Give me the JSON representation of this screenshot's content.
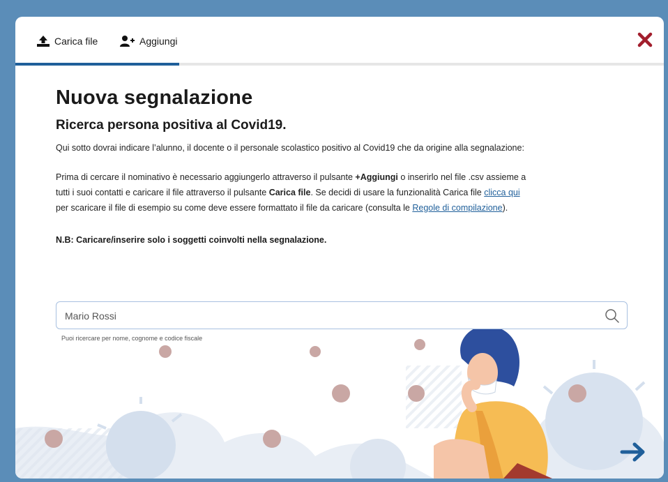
{
  "tabs": {
    "upload_label": "Carica file",
    "add_label": "Aggiungi"
  },
  "header": {
    "title": "Nuova segnalazione",
    "subtitle": "Ricerca persona positiva al Covid19."
  },
  "body": {
    "intro": "Qui sotto dovrai indicare l’alunno, il docente o il personale scolastico positivo al Covid19 che da origine alla segnalazione:",
    "p2_part1": "Prima di cercare il nominativo è necessario aggiungerlo attraverso il pulsante ",
    "p2_bold1": "+Aggiungi",
    "p2_part2": " o inserirlo nel file .csv assieme a tutti i suoi contatti e caricare il file attraverso il pulsante ",
    "p2_bold2": "Carica file",
    "p2_part3": ". Se decidi di usare la funzionalità Carica file ",
    "p2_link1": "clicca qui",
    "p2_part4": " per scaricare il file di esempio su come deve essere formattato il file da caricare (consulta le ",
    "p2_link2": "Regole di compilazione",
    "p2_part5": ").",
    "nb": "N.B: Caricare/inserire solo i soggetti coinvolti nella segnalazione."
  },
  "search": {
    "placeholder": "Mario Rossi",
    "hint": "Puoi ricercare per nome, cognome e codice fiscale"
  },
  "icons": {
    "upload": "upload-icon",
    "add_user": "add-user-icon",
    "close": "close-icon",
    "search": "search-icon",
    "next": "arrow-right-icon"
  },
  "colors": {
    "accent": "#1f5f9a",
    "close": "#a21e2d",
    "background": "#5b8db8"
  }
}
